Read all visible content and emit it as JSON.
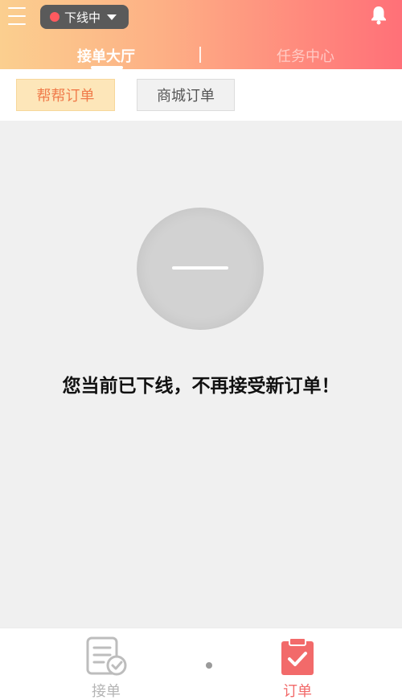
{
  "header": {
    "status_label": "下线中",
    "tabs": [
      {
        "label": "接单大厅",
        "active": true
      },
      {
        "label": "任务中心",
        "active": false
      }
    ]
  },
  "subtabs": [
    {
      "label": "帮帮订单",
      "active": true
    },
    {
      "label": "商城订单",
      "active": false
    }
  ],
  "empty_state": {
    "message": "您当前已下线，不再接受新订单！"
  },
  "bottom_nav": [
    {
      "label": "接单",
      "icon": "document-check-icon",
      "active": false
    },
    {
      "label": "订单",
      "icon": "clipboard-check-icon",
      "active": true
    }
  ],
  "colors": {
    "header_gradient_start": "#fbcf8f",
    "header_gradient_end": "#ff7078",
    "active_accent": "#f26a6a",
    "offline_dot": "#ff5a5f"
  }
}
